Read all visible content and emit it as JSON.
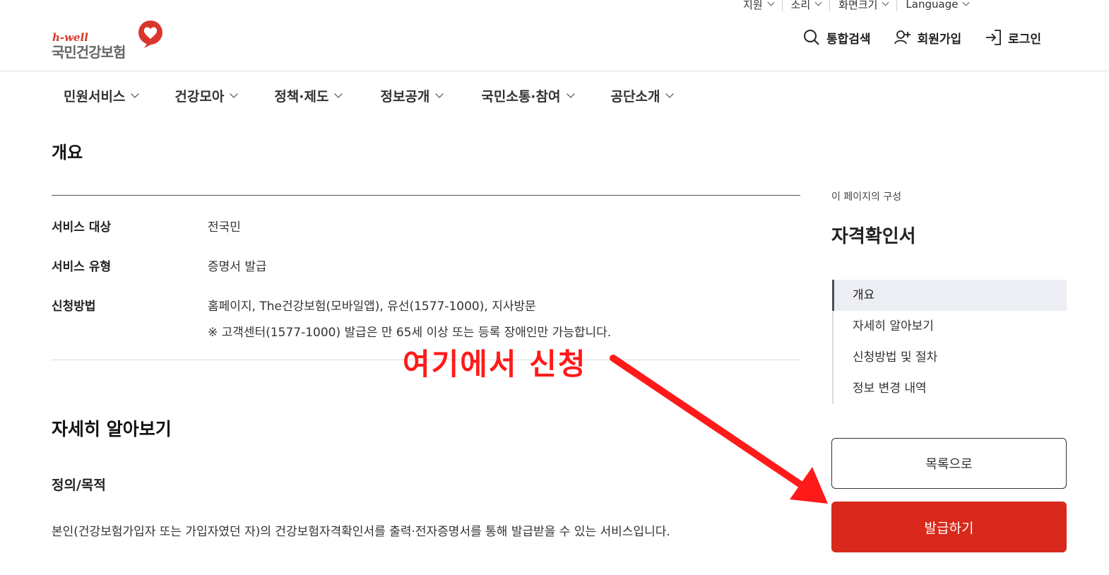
{
  "util_nav": [
    {
      "label": "지원"
    },
    {
      "label": "소리"
    },
    {
      "label": "화면크기"
    },
    {
      "label": "Language"
    }
  ],
  "logo": {
    "brand": "h-well",
    "name": "국민건강보험"
  },
  "header_tools": {
    "search": "통합검색",
    "signup": "회원가입",
    "login": "로그인"
  },
  "gnb": [
    {
      "label": "민원서비스"
    },
    {
      "label": "건강모아"
    },
    {
      "label": "정책·제도"
    },
    {
      "label": "정보공개"
    },
    {
      "label": "국민소통·참여"
    },
    {
      "label": "공단소개"
    }
  ],
  "overview": {
    "title": "개요",
    "rows": [
      {
        "key": "서비스 대상",
        "value": "전국민"
      },
      {
        "key": "서비스 유형",
        "value": "증명서 발급"
      },
      {
        "key": "신청방법",
        "value": "홈페이지, The건강보험(모바일앱), 유선(1577-1000), 지사방문"
      }
    ],
    "note": "※ 고객센터(1577-1000) 발급은 만 65세 이상 또는 등록 장애인만 가능합니다."
  },
  "detail": {
    "title": "자세히 알아보기",
    "subtitle": "정의/목적",
    "description": "본인(건강보험가입자 또는 가입자였던 자)의 건강보험자격확인서를 출력·전자증명서를 통해 발급받을 수 있는 서비스입니다."
  },
  "annotation": {
    "text": "여기에서 신청",
    "color": "#ff1a1a"
  },
  "side": {
    "caption": "이 페이지의 구성",
    "title": "자격확인서",
    "toc": [
      {
        "label": "개요"
      },
      {
        "label": "자세히 알아보기"
      },
      {
        "label": "신청방법 및 절차"
      },
      {
        "label": "정보 변경 내역"
      }
    ],
    "list_button": "목록으로",
    "issue_button": "발급하기",
    "accent": "#d8291c"
  }
}
